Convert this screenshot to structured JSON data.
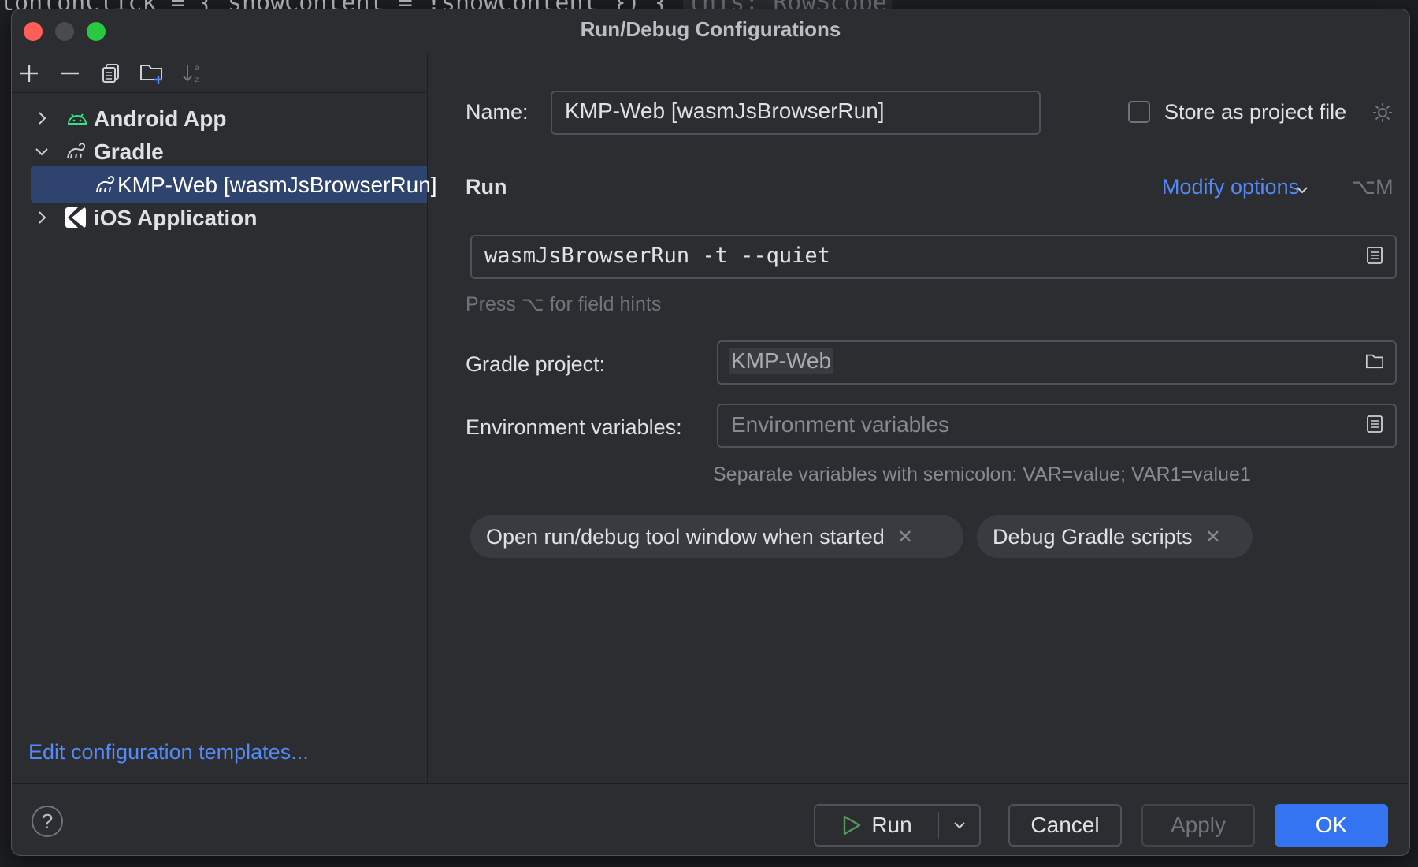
{
  "background": {
    "code_line": "ton(onClick = { showContent = !showContent }) { ",
    "code_hint": "this: RowScope"
  },
  "window": {
    "title": "Run/Debug Configurations"
  },
  "tree": {
    "items": [
      {
        "label": "Android App",
        "expanded": false,
        "icon": "android-icon"
      },
      {
        "label": "Gradle",
        "expanded": true,
        "icon": "gradle-icon"
      },
      {
        "label": "KMP-Web [wasmJsBrowserRun]",
        "selected": true,
        "icon": "gradle-icon"
      },
      {
        "label": "iOS Application",
        "expanded": false,
        "icon": "ios-app-icon"
      }
    ],
    "edit_templates": "Edit configuration templates..."
  },
  "form": {
    "name_label": "Name:",
    "name_value": "KMP-Web [wasmJsBrowserRun]",
    "store_label": "Store as project file",
    "run_section": "Run",
    "modify_options": "Modify options",
    "modify_shortcut": "⌥M",
    "run_value": "wasmJsBrowserRun -t --quiet",
    "field_hint": "Press ⌥ for field hints",
    "gradle_project_label": "Gradle project:",
    "gradle_project_value": "KMP-Web",
    "env_label": "Environment variables:",
    "env_placeholder": "Environment variables",
    "env_hint": "Separate variables with semicolon: VAR=value; VAR1=value1",
    "chips": [
      "Open run/debug tool window when started",
      "Debug Gradle scripts"
    ]
  },
  "footer": {
    "help": "?",
    "run": "Run",
    "cancel": "Cancel",
    "apply": "Apply",
    "ok": "OK"
  },
  "colors": {
    "accent": "#3574f0",
    "link": "#548af7",
    "selection": "#2e436e",
    "android_green": "#3ddc84"
  }
}
